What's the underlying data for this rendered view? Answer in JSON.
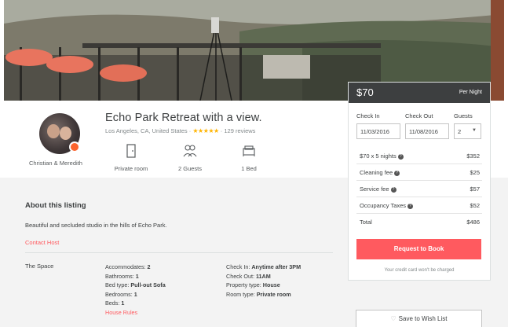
{
  "colors": {
    "accent": "#ff5a5f",
    "header": "#3d3f40",
    "star": "#ffb400",
    "badge": "#fc642d"
  },
  "hero": {
    "image": "hillside-balcony-photo"
  },
  "host": {
    "name": "Christian & Meredith",
    "avatar": "host-avatar",
    "badge_icon": "superhost-badge-icon"
  },
  "listing": {
    "title": "Echo Park Retreat with a view.",
    "location": "Los Angeles, CA, United States",
    "rating_stars": 5,
    "stars_text": "★★★★★",
    "reviews": "129 reviews",
    "separator": "·"
  },
  "amenities": [
    {
      "label": "Private room",
      "icon": "door-icon"
    },
    {
      "label": "2 Guests",
      "icon": "guests-icon"
    },
    {
      "label": "1 Bed",
      "icon": "bed-icon"
    }
  ],
  "about": {
    "title": "About this listing",
    "text": "Beautiful and secluded studio in the hills of Echo Park.",
    "contact": "Contact Host"
  },
  "space": {
    "label": "The Space",
    "col1": [
      {
        "k": "Accommodates: ",
        "v": "2"
      },
      {
        "k": "Bathrooms: ",
        "v": "1"
      },
      {
        "k": "Bed type: ",
        "v": "Pull-out Sofa"
      },
      {
        "k": "Bedrooms: ",
        "v": "1"
      },
      {
        "k": "Beds: ",
        "v": "1"
      }
    ],
    "house_rules": "House Rules",
    "col2": [
      {
        "k": "Check In: ",
        "v": "Anytime after 3PM"
      },
      {
        "k": "Check Out: ",
        "v": "11AM"
      },
      {
        "k": "Property type: ",
        "v": "House"
      },
      {
        "k": "Room type: ",
        "v": "Private room"
      }
    ]
  },
  "booking": {
    "price": "$70",
    "per_night": "Per Night",
    "check_in_label": "Check In",
    "check_out_label": "Check Out",
    "guests_label": "Guests",
    "check_in": "11/03/2016",
    "check_out": "11/08/2016",
    "guests": "2",
    "rows": [
      {
        "label": "$70 x 5 nights",
        "help": true,
        "value": "$352"
      },
      {
        "label": "Cleaning fee",
        "help": true,
        "value": "$25"
      },
      {
        "label": "Service fee",
        "help": true,
        "value": "$57"
      },
      {
        "label": "Occupancy Taxes",
        "help": true,
        "value": "$52"
      },
      {
        "label": "Total",
        "help": false,
        "value": "$486"
      }
    ],
    "request_label": "Request to Book",
    "note": "Your credit card won't be charged",
    "help_glyph": "?"
  },
  "wishlist": {
    "label": "Save to Wish List",
    "icon": "heart-icon",
    "glyph": "♡"
  }
}
